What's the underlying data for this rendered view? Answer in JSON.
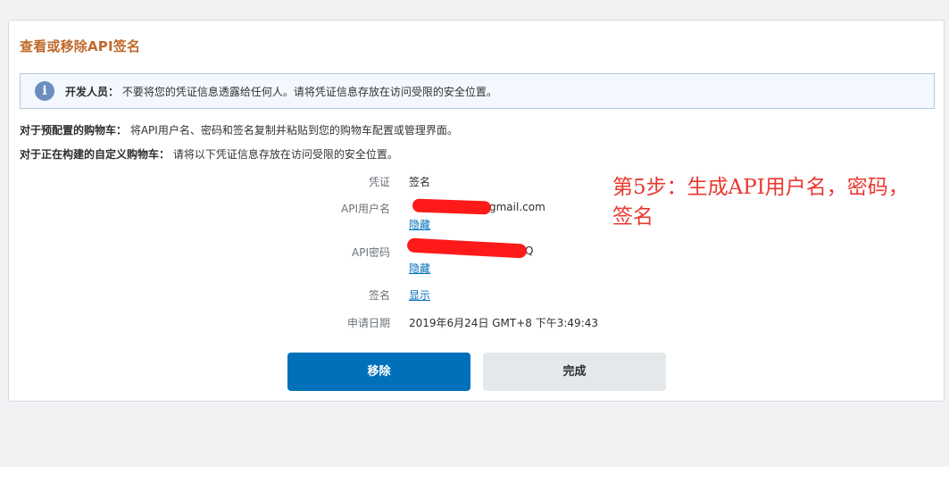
{
  "dialog": {
    "title": "查看或移除API签名"
  },
  "notice": {
    "label": "开发人员：",
    "text": "不要将您的凭证信息透露给任何人。请将凭证信息存放在访问受限的安全位置。"
  },
  "instructions": {
    "preconfigured_label": "对于预配置的购物车：",
    "preconfigured_text": "将API用户名、密码和签名复制并粘贴到您的购物车配置或管理界面。",
    "custom_label": "对于正在构建的自定义购物车：",
    "custom_text": "请将以下凭证信息存放在访问受限的安全位置。"
  },
  "credentials": {
    "type_label": "凭证",
    "type_value": "签名",
    "username_label": "API用户名",
    "username_value": "gmail.com",
    "username_toggle": "隐藏",
    "password_label": "API密码",
    "password_value": "Q",
    "password_toggle": "隐藏",
    "signature_label": "签名",
    "signature_toggle": "显示",
    "date_label": "申请日期",
    "date_value": "2019年6月24日 GMT+8 下午3:49:43"
  },
  "actions": {
    "remove_label": "移除",
    "done_label": "完成"
  },
  "annotation": {
    "text": "第5步：生成API用户名，密码，签名"
  },
  "colors": {
    "title": "#c06a2b",
    "primary_button": "#0070ba",
    "secondary_button": "#e5e8ea",
    "link": "#0070ba",
    "annotation": "#e8392f",
    "redaction": "#ff1a1a"
  }
}
